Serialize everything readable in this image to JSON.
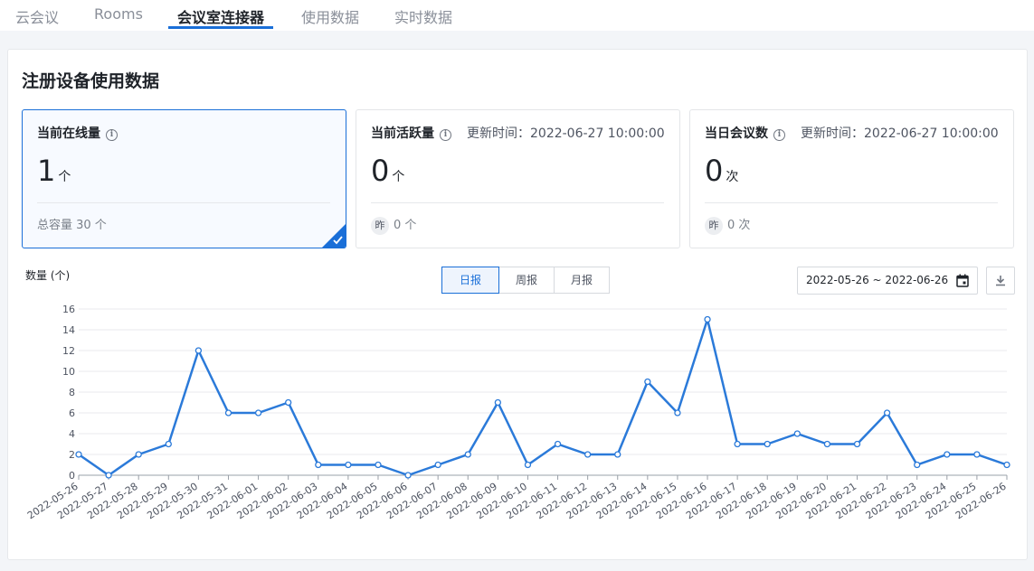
{
  "nav": {
    "tabs": [
      {
        "label": "云会议",
        "active": false
      },
      {
        "label": "Rooms",
        "active": false
      },
      {
        "label": "会议室连接器",
        "active": true
      },
      {
        "label": "使用数据",
        "active": false
      },
      {
        "label": "实时数据",
        "active": false
      }
    ]
  },
  "panel": {
    "title": "注册设备使用数据"
  },
  "cards": [
    {
      "label": "当前在线量",
      "update_time": "",
      "value": "1",
      "unit": "个",
      "foot": "总容量 30 个",
      "badge": "",
      "selected": true
    },
    {
      "label": "当前活跃量",
      "update_time": "更新时间：2022-06-27 10:00:00",
      "value": "0",
      "unit": "个",
      "foot": "0 个",
      "badge": "昨",
      "selected": false
    },
    {
      "label": "当日会议数",
      "update_time": "更新时间：2022-06-27 10:00:00",
      "value": "0",
      "unit": "次",
      "foot": "0 次",
      "badge": "昨",
      "selected": false
    }
  ],
  "toolbar": {
    "y_unit": "数量 (个)",
    "periods": [
      {
        "label": "日报",
        "active": true
      },
      {
        "label": "周报",
        "active": false
      },
      {
        "label": "月报",
        "active": false
      }
    ],
    "date_range": "2022-05-26 ~ 2022-06-26"
  },
  "colors": {
    "accent": "#1a6fd8",
    "line": "#2b7ad9"
  },
  "icons": [
    "info-icon",
    "check-icon",
    "calendar-icon",
    "download-icon"
  ],
  "chart_data": {
    "type": "line",
    "title": "",
    "xlabel": "",
    "ylabel": "数量 (个)",
    "ylim": [
      0,
      16
    ],
    "yticks": [
      0,
      2,
      4,
      6,
      8,
      10,
      12,
      14,
      16
    ],
    "grid": true,
    "categories": [
      "2022-05-26",
      "2022-05-27",
      "2022-05-28",
      "2022-05-29",
      "2022-05-30",
      "2022-05-31",
      "2022-06-01",
      "2022-06-02",
      "2022-06-03",
      "2022-06-04",
      "2022-06-05",
      "2022-06-06",
      "2022-06-07",
      "2022-06-08",
      "2022-06-09",
      "2022-06-10",
      "2022-06-11",
      "2022-06-12",
      "2022-06-13",
      "2022-06-14",
      "2022-06-15",
      "2022-06-16",
      "2022-06-17",
      "2022-06-18",
      "2022-06-19",
      "2022-06-20",
      "2022-06-21",
      "2022-06-22",
      "2022-06-23",
      "2022-06-24",
      "2022-06-25",
      "2022-06-26"
    ],
    "values": [
      2,
      0,
      2,
      3,
      12,
      6,
      6,
      7,
      1,
      1,
      1,
      0,
      1,
      2,
      7,
      1,
      3,
      2,
      2,
      9,
      6,
      15,
      3,
      3,
      4,
      3,
      3,
      6,
      1,
      2,
      2,
      1
    ]
  }
}
